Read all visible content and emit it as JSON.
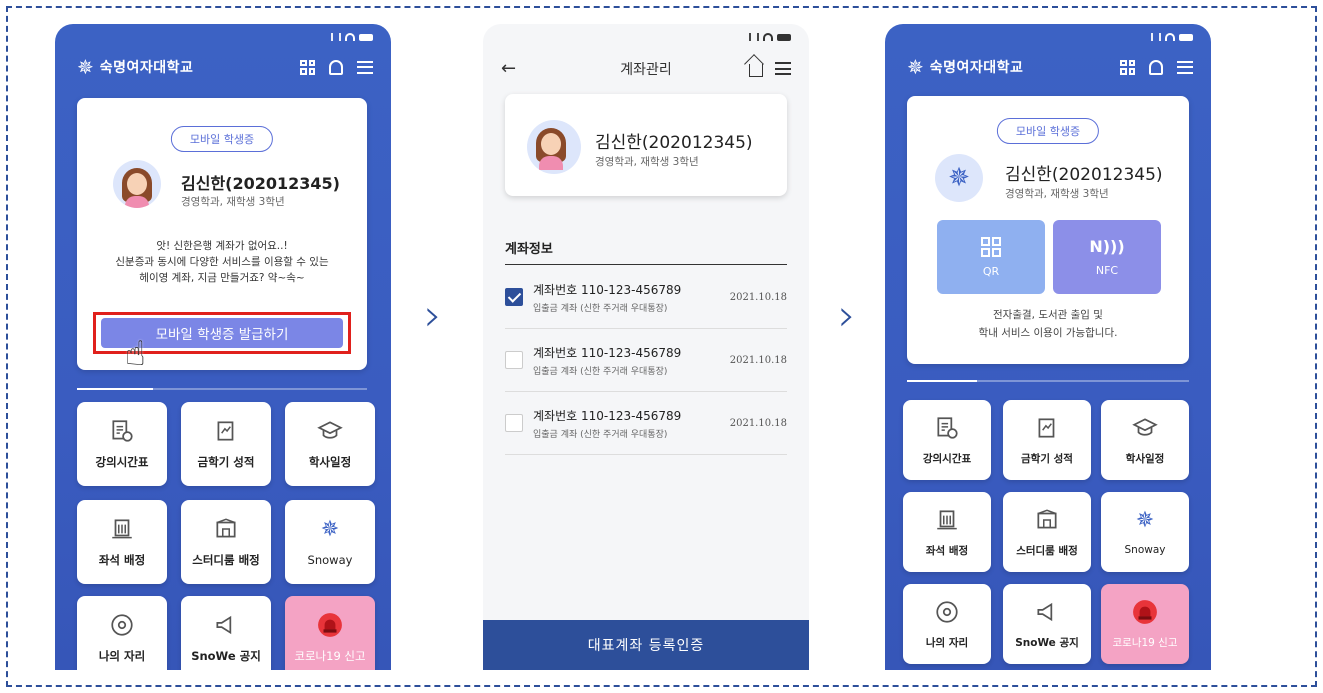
{
  "university": "숙명여자대학교",
  "student": {
    "name": "김신한(202012345)",
    "dept": "경영학과, 재학생 3학년",
    "badge": "모바일 학생증"
  },
  "screen1": {
    "notice": [
      "앗! 신한은행 계좌가 없어요..!",
      "신분증과 동시에 다양한 서비스를 이용할 수 있는",
      "헤이영 계좌, 지금 만들거죠? 약~속~"
    ],
    "issue_button": "모바일 학생증 발급하기"
  },
  "menu": [
    {
      "label": "강의시간표",
      "icon": "timetable-icon"
    },
    {
      "label": "금학기 성적",
      "icon": "grades-icon"
    },
    {
      "label": "학사일정",
      "icon": "graduation-cap-icon"
    },
    {
      "label": "좌석 배정",
      "icon": "building-icon"
    },
    {
      "label": "스터디룸 배정",
      "icon": "study-room-icon"
    },
    {
      "label": "Snoway",
      "icon": "snoway-icon"
    },
    {
      "label": "나의 자리",
      "icon": "location-icon"
    },
    {
      "label": "SnoWe 공지",
      "icon": "megaphone-icon"
    },
    {
      "label": "코로나19 신고",
      "icon": "siren-icon"
    }
  ],
  "screen2": {
    "title": "계좌관리",
    "section": "계좌정보",
    "accounts": [
      {
        "no": "계좌번호 110-123-456789",
        "sub": "입출금 계좌 (신한 주거래 우대통장)",
        "date": "2021.10.18",
        "checked": true
      },
      {
        "no": "계좌번호 110-123-456789",
        "sub": "입출금 계좌 (신한 주거래 우대통장)",
        "date": "2021.10.18",
        "checked": false
      },
      {
        "no": "계좌번호 110-123-456789",
        "sub": "입출금 계좌 (신한 주거래 우대통장)",
        "date": "2021.10.18",
        "checked": false
      }
    ],
    "register_button": "대표계좌 등록인증"
  },
  "screen3": {
    "qr": "QR",
    "nfc": "NFC",
    "info": [
      "전자출결, 도서관 출입 및",
      "학내 서비스 이용이 가능합니다."
    ]
  },
  "colors": {
    "primary": "#3c62c4",
    "navy": "#2d4f9a",
    "accent_pink": "#f4a3c4",
    "highlight_red": "#e0201c"
  }
}
